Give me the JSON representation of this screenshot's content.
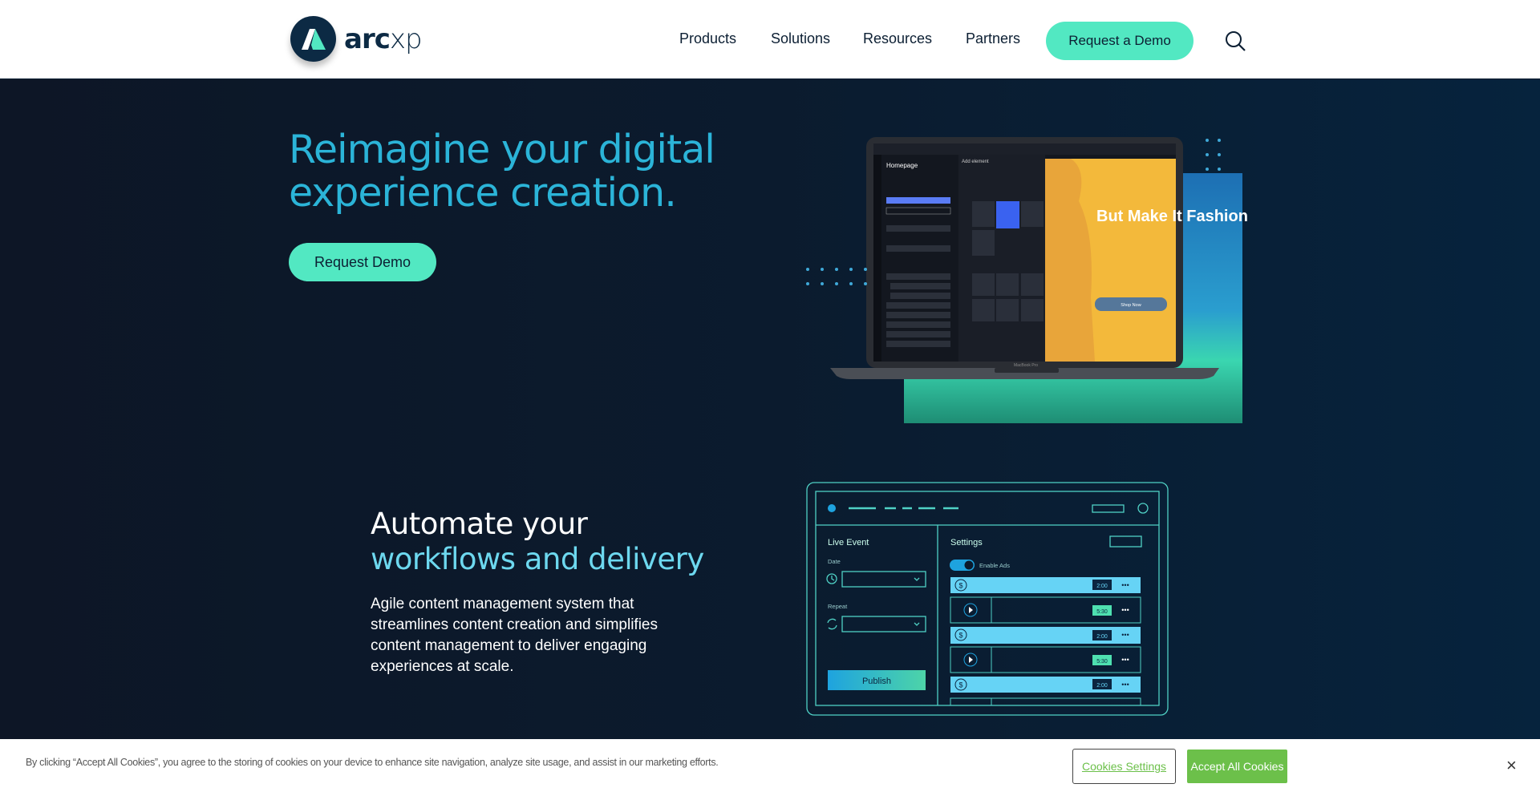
{
  "header": {
    "logo_text": "arcxp",
    "nav": [
      "Products",
      "Solutions",
      "Resources",
      "Partners"
    ],
    "cta": "Request a Demo",
    "search_icon": "search-icon"
  },
  "hero": {
    "title": "Reimagine your digital experience creation.",
    "cta": "Request Demo"
  },
  "laptop": {
    "page": "Homepage",
    "panel_title": "Add element",
    "promo_heading": "But Make It Fashion",
    "shop_button": "Shop Now",
    "brand": "MacBook Pro"
  },
  "section2": {
    "title_plain": "Automate your ",
    "title_highlight": "workflows and delivery",
    "body": "Agile content management system that streamlines content creation and simplifies content management to deliver engaging experiences at scale."
  },
  "workflow": {
    "left_title": "Live Event",
    "date_label": "Date",
    "repeat_label": "Repeat",
    "publish": "Publish",
    "right_title": "Settings",
    "toggle_label": "Enable Ads",
    "toggle_on": true,
    "rows": [
      {
        "type": "ad",
        "time": "2:00"
      },
      {
        "type": "video",
        "time": "5:30"
      },
      {
        "type": "ad",
        "time": "2:00"
      },
      {
        "type": "video",
        "time": "5:30"
      },
      {
        "type": "ad",
        "time": "2:00"
      }
    ]
  },
  "cookie": {
    "text": "By clicking “Accept All Cookies”, you agree to the storing of cookies on your device to enhance site navigation, analyze site usage, and assist in our marketing efforts.",
    "settings": "Cookies Settings",
    "accept": "Accept All Cookies",
    "close": "×"
  },
  "colors": {
    "accent": "#52e8c2",
    "title": "#2bb4d8",
    "navy": "#0c2a44",
    "cookie_green": "#6cc04a"
  }
}
